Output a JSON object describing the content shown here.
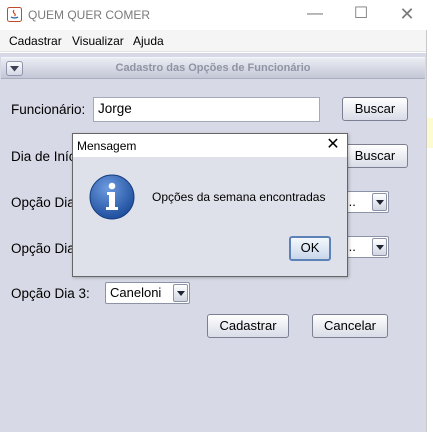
{
  "window": {
    "title": "QUEM QUER COMER",
    "minimize_glyph": "—",
    "maximize_glyph": "☐",
    "close_glyph": "✕"
  },
  "menu": {
    "items": [
      "Cadastrar",
      "Visualizar",
      "Ajuda"
    ]
  },
  "section": {
    "title": "Cadastro das Opções de Funcionário"
  },
  "form": {
    "funcionario_label": "Funcionário:",
    "funcionario_value": "Jorge",
    "buscar_label": "Buscar",
    "dia_inicio_label": "Dia de Iníc",
    "buscar2_label": "Buscar",
    "opcao1_label": "Opção Dia",
    "opcao1_value": "...",
    "opcao2_label": "Opção Dia",
    "opcao2_value": "...",
    "opcao3_label": "Opção Dia 3:",
    "opcao3_value": "Caneloni",
    "cadastrar_label": "Cadastrar",
    "cancelar_label": "Cancelar"
  },
  "dialog": {
    "title": "Mensagem",
    "close_glyph": "✕",
    "message": "Opções da semana encontradas",
    "ok_label": "OK",
    "icon": "info-icon"
  },
  "colors": {
    "panel_bg": "#d7d9e6",
    "dialog_bg": "#dfe1ea",
    "info_icon_blue": "#2c63b8",
    "ok_border": "#5d82b8"
  }
}
